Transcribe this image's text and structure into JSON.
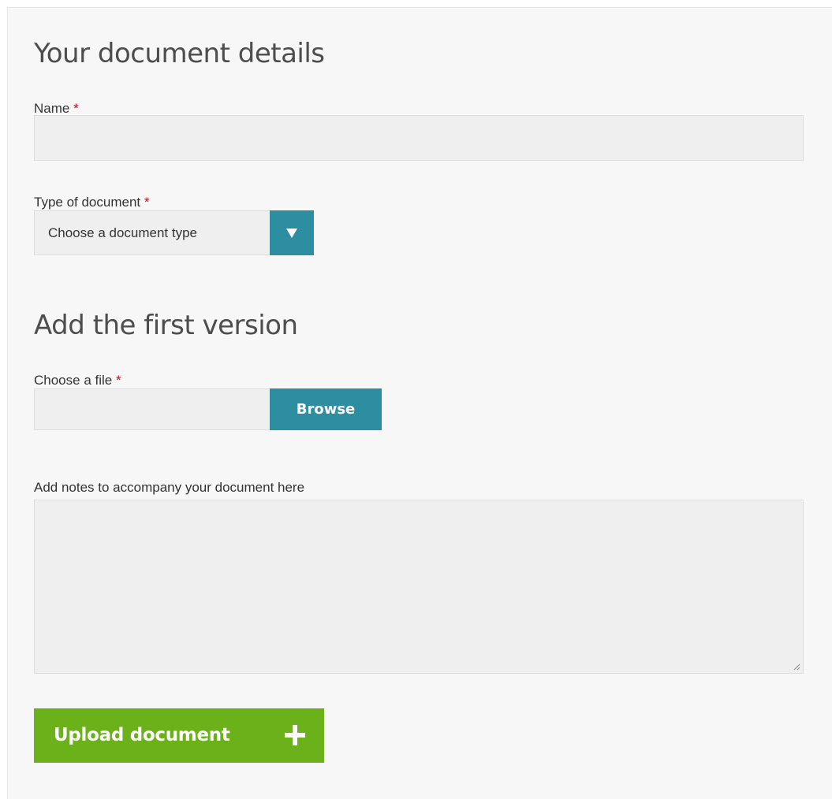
{
  "section_details": {
    "title": "Your document details"
  },
  "name_field": {
    "label": "Name",
    "required_marker": "*",
    "value": ""
  },
  "doc_type_field": {
    "label": "Type of document",
    "required_marker": "*",
    "selected": "Choose a document type",
    "icon": "triangle-down-icon"
  },
  "section_version": {
    "title": "Add the first version"
  },
  "file_field": {
    "label": "Choose a file",
    "required_marker": "*",
    "value": "",
    "browse_label": "Browse"
  },
  "notes_field": {
    "label": "Add notes to accompany your document here",
    "value": ""
  },
  "upload_button": {
    "label": "Upload document",
    "icon": "plus-icon"
  },
  "colors": {
    "accent_teal": "#2e8ea1",
    "accent_green": "#6ab11a",
    "required_red": "#d0021b",
    "panel_bg": "#f7f7f7",
    "field_bg": "#efefef"
  }
}
